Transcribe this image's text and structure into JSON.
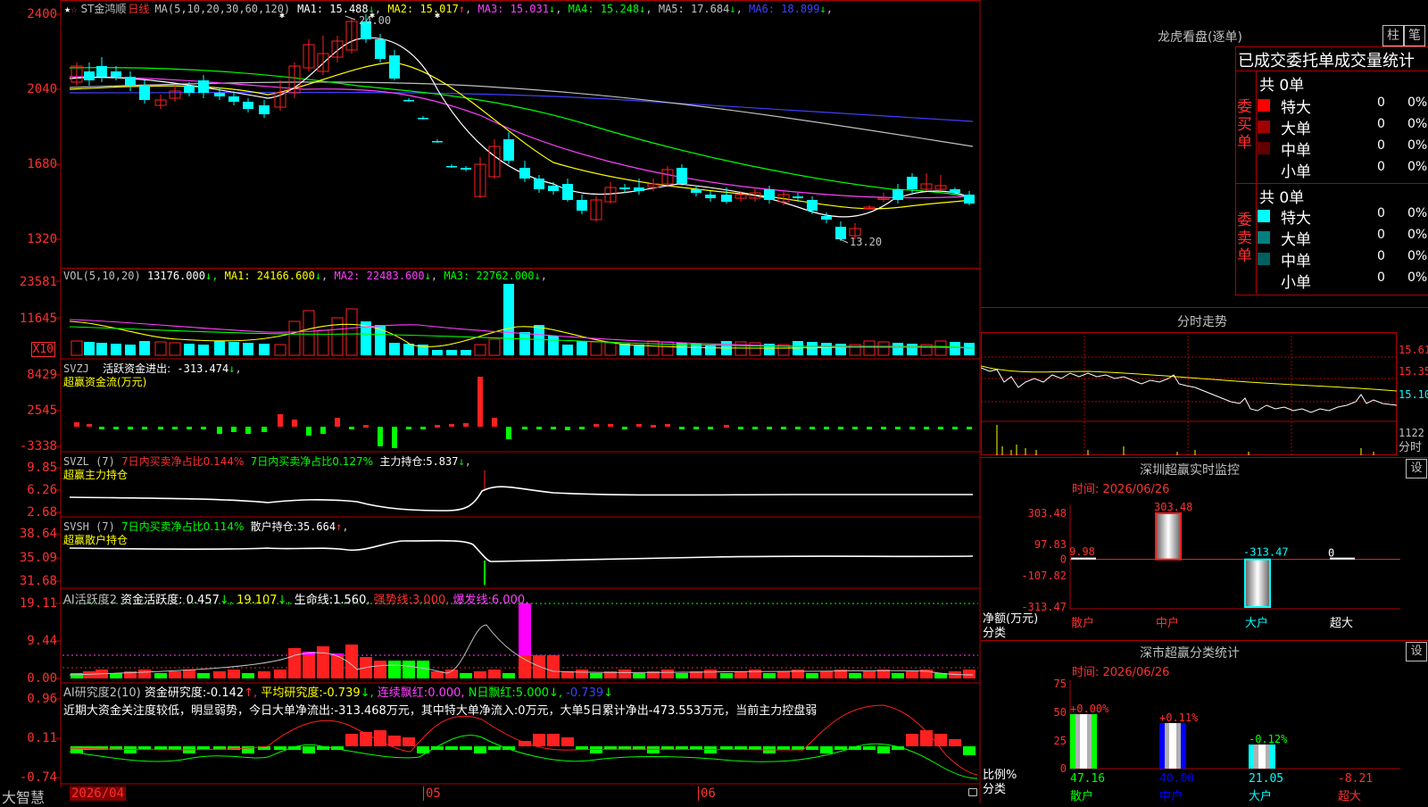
{
  "colors": {
    "up": "#ff2020",
    "down": "#00ffff",
    "ma1": "#ffffff",
    "ma2": "#ffff00",
    "ma3": "#ff40ff",
    "ma4": "#00ff00",
    "ma5": "#c0c0c0",
    "ma6": "#4040ff",
    "grid": "#b00000",
    "green": "#00ff00"
  },
  "main": {
    "star": "★",
    "star2": "☆",
    "stock_name": "ST金鸿顺",
    "period": "日线",
    "ma_spec": "MA(5,10,20,30,60,120)",
    "ma_items": [
      {
        "label": "MA1:",
        "value": "15.488",
        "arrow": "↓",
        "color": "#ffffff"
      },
      {
        "label": "MA2:",
        "value": "15.017",
        "arrow": "↑",
        "color": "#ffff00"
      },
      {
        "label": "MA3:",
        "value": "15.031",
        "arrow": "↓",
        "color": "#ff40ff"
      },
      {
        "label": "MA4:",
        "value": "15.248",
        "arrow": "↓",
        "color": "#00ff00"
      },
      {
        "label": "MA5:",
        "value": "17.684",
        "arrow": "↓",
        "color": "#c0c0c0"
      },
      {
        "label": "MA6:",
        "value": "18.899",
        "arrow": "↓",
        "color": "#4040ff"
      }
    ],
    "yticks": [
      "2400",
      "2040",
      "1680",
      "1320"
    ],
    "high_label": "24.00",
    "low_label": "13.20"
  },
  "vol": {
    "title": "VOL(5,10,20)",
    "value": "13176.000",
    "items": [
      {
        "label": "MA1:",
        "value": "24166.600",
        "arrow": "↓",
        "color": "#ffff00"
      },
      {
        "label": "MA2:",
        "value": "22483.600",
        "arrow": "↓",
        "color": "#ff40ff"
      },
      {
        "label": "MA3:",
        "value": "22762.000",
        "arrow": "↓",
        "color": "#00ff00"
      }
    ],
    "yticks": [
      "23581",
      "11645"
    ],
    "unit": "X10"
  },
  "svzj": {
    "title": "SVZJ",
    "label": "活跃资金进出:",
    "value": "-313.474",
    "arrow": "↓",
    "subtitle": "超赢资金流(万元)",
    "yticks": [
      "8429",
      "2545",
      "-3338"
    ]
  },
  "svzl": {
    "title": "SVZL (7)",
    "r1": "7日内买卖净占比0.144%",
    "r2": "7日内买卖净占比0.127%",
    "r3": "主力持仓:",
    "r3v": "5.837",
    "arrow": "↓",
    "subtitle": "超赢主力持仓",
    "yticks": [
      "9.85",
      "6.26",
      "2.68"
    ]
  },
  "svsh": {
    "title": "SVSH (7)",
    "r1": "7日内买卖净占比0.114%",
    "r2": "散户持仓:",
    "r2v": "35.664",
    "arrow": "↑",
    "subtitle": "超赢散户持仓",
    "yticks": [
      "38.64",
      "35.09",
      "31.68"
    ]
  },
  "ai1": {
    "title": "AI活跃度2",
    "label": "资金活跃度:",
    "v1": "0.457",
    "v2": "19.107",
    "label2": "生命线:",
    "v3": "1.560",
    "label3": "强势线:",
    "v4": "3.000",
    "label4": "爆发线:",
    "v5": "6.000",
    "yticks": [
      "19.11",
      "9.44",
      "0.00"
    ]
  },
  "ai2": {
    "title": "AI研究度2(10)",
    "label": "资金研究度:",
    "v1": "-0.142",
    "label2": "平均研究度:",
    "v2": "-0.739",
    "label3": "连续飘红:",
    "v3": "0.000",
    "label4": "N日飘红:",
    "v4": "5.000",
    "v5": "-0.739",
    "comment": "近期大资金关注度较低，明显弱势，今日大单净流出:-313.468万元，其中特大单净流入:0万元，大单5日累计净出-473.553万元，当前主力控盘弱",
    "yticks": [
      "0.96",
      "0.11",
      "-0.74"
    ]
  },
  "bottom": {
    "brand": "大智慧",
    "date": "2026/04",
    "m05": "05",
    "m06": "06"
  },
  "lhb": {
    "title": "龙虎看盘(逐单)",
    "btn_zhu": "柱",
    "btn_bi": "笔",
    "header": "已成交委托单成交量统计",
    "buy_label": "委买单",
    "sell_label": "委卖单",
    "buy_total": "共 0单",
    "sell_total": "共 0单",
    "buy_rows": [
      {
        "name": "特大",
        "count": "0",
        "pct": "0%",
        "color": "#ff0000"
      },
      {
        "name": "大单",
        "count": "0",
        "pct": "0%",
        "color": "#a00000"
      },
      {
        "name": "中单",
        "count": "0",
        "pct": "0%",
        "color": "#600000"
      },
      {
        "name": "小单",
        "count": "0",
        "pct": "0%",
        "color": "#000000"
      }
    ],
    "sell_rows": [
      {
        "name": "特大",
        "count": "0",
        "pct": "0%",
        "color": "#00ffff"
      },
      {
        "name": "大单",
        "count": "0",
        "pct": "0%",
        "color": "#008080"
      },
      {
        "name": "中单",
        "count": "0",
        "pct": "0%",
        "color": "#006060"
      },
      {
        "name": "小单",
        "count": "0",
        "pct": "0%",
        "color": "#000000"
      }
    ]
  },
  "fenshi": {
    "title": "分时走势",
    "yticks": [
      "15.61",
      "15.35",
      "15.10"
    ],
    "vol": "1122",
    "vol_label": "分时"
  },
  "monitor": {
    "title": "深圳超赢实时监控",
    "set": "设",
    "time_label": "时间: 2026/06/26",
    "yticks": [
      "303.48",
      "97.83",
      "0",
      "-107.82",
      "-313.47"
    ],
    "net_label": "净额(万元)",
    "cat_label": "分类",
    "labels": [
      "散户",
      "中户",
      "大户",
      "超大"
    ],
    "values": [
      "9.98",
      "303.48",
      "-313.47",
      "0"
    ]
  },
  "stats": {
    "title": "深市超赢分类统计",
    "set": "设",
    "time_label": "时间: 2026/06/26",
    "yticks": [
      "75",
      "50",
      "25",
      "0"
    ],
    "ratio_label": "比例%",
    "cat_label": "分类",
    "labels": [
      "散户",
      "中户",
      "大户",
      "超大"
    ],
    "changes": [
      "+0.00%",
      "+0.11%",
      "-0.12%"
    ],
    "values": [
      "47.16",
      "40.00",
      "21.05",
      "-8.21"
    ]
  },
  "chart_data": {
    "type": "bar",
    "title": "深圳超赢实时监控",
    "categories": [
      "散户",
      "中户",
      "大户",
      "超大"
    ],
    "values": [
      9.98,
      303.48,
      -313.47,
      0
    ],
    "ylabel": "净额(万元)",
    "ylim": [
      -313.47,
      303.48
    ]
  }
}
